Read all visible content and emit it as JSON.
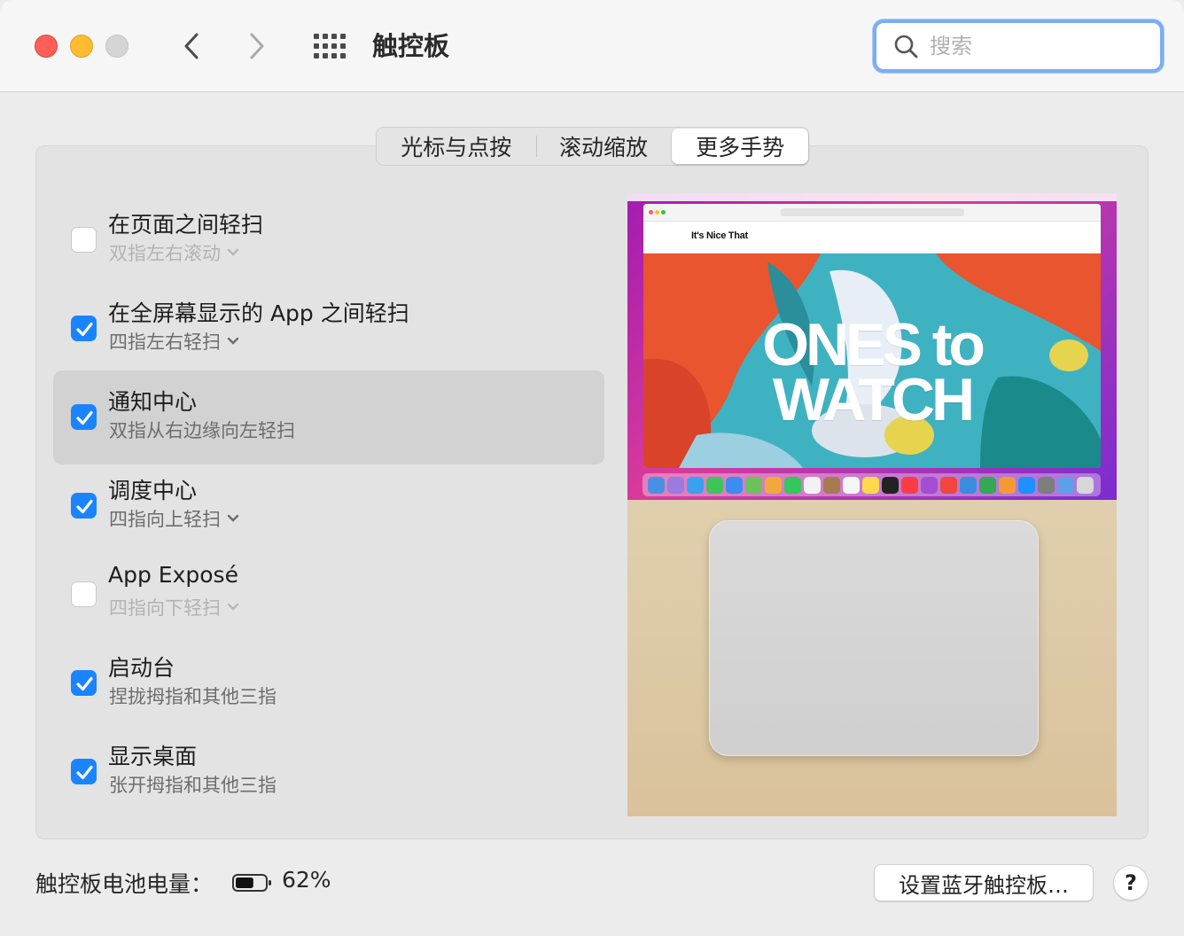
{
  "window": {
    "title": "触控板",
    "search_placeholder": "搜索"
  },
  "tabs": [
    {
      "label": "光标与点按",
      "selected": false
    },
    {
      "label": "滚动缩放",
      "selected": false
    },
    {
      "label": "更多手势",
      "selected": true
    }
  ],
  "gestures": [
    {
      "title": "在页面之间轻扫",
      "subtitle": "双指左右滚动",
      "checked": false,
      "has_dropdown": true,
      "selected": false
    },
    {
      "title": "在全屏幕显示的 App 之间轻扫",
      "subtitle": "四指左右轻扫",
      "checked": true,
      "has_dropdown": true,
      "selected": false
    },
    {
      "title": "通知中心",
      "subtitle": "双指从右边缘向左轻扫",
      "checked": true,
      "has_dropdown": false,
      "selected": true
    },
    {
      "title": "调度中心",
      "subtitle": "四指向上轻扫",
      "checked": true,
      "has_dropdown": true,
      "selected": false
    },
    {
      "title": "App Exposé",
      "subtitle": "四指向下轻扫",
      "checked": false,
      "has_dropdown": true,
      "selected": false
    },
    {
      "title": "启动台",
      "subtitle": "捏拢拇指和其他三指",
      "checked": true,
      "has_dropdown": false,
      "selected": false
    },
    {
      "title": "显示桌面",
      "subtitle": "张开拇指和其他三指",
      "checked": true,
      "has_dropdown": false,
      "selected": false
    }
  ],
  "preview": {
    "site_logo": "It's Nice That",
    "headline_line1": "ONES to",
    "headline_line2": "WATCH"
  },
  "footer": {
    "battery_label": "触控板电池电量：",
    "battery_percent": "62%",
    "battery_level": 0.62,
    "setup_button": "设置蓝牙触控板…",
    "help_button": "?"
  },
  "colors": {
    "accent": "#1a84ff",
    "close": "#ff5f57",
    "minimize": "#febc2e",
    "search_focus": "#7cadf4"
  }
}
